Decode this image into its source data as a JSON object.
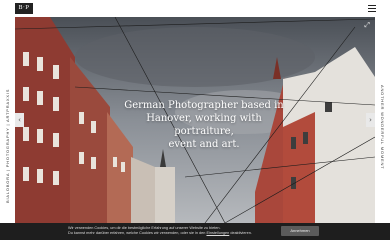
{
  "brand": {
    "logo_text": "B·P"
  },
  "header": {
    "menu_icon": "hamburger-icon"
  },
  "side_left": {
    "text": "BIALOBORA | PHOTOGRAPHY | ARTPRAXXIS"
  },
  "side_right": {
    "text": "ANOTHER WONDERFUL MOMENT"
  },
  "hero": {
    "headline_line1": "German Photographer based in",
    "headline_line2": "Hanover, working with portraiture,",
    "headline_line3": "event and art.",
    "expand_icon": "expand-icon",
    "prev_icon": "chevron-left-icon",
    "next_icon": "chevron-right-icon"
  },
  "cookie": {
    "line1": "Wir verwenden Cookies, um dir die bestmögliche Erfahrung auf unserer Website zu bieten.",
    "line2_before": "Du kannst mehr darüber erfahren, welche Cookies wir verwenden, oder sie in den",
    "link": "Einstellungen",
    "line2_after": "deaktivieren.",
    "button": "Annehmen"
  }
}
